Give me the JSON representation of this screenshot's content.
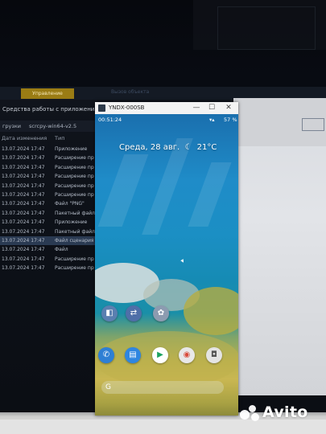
{
  "explorer": {
    "ribbon_tab": "Управление",
    "ribbon_tab2": "Вызов объекта",
    "title": "Средства работы с приложениями",
    "path_part1": "грузки",
    "path_part2": "scrcpy-win64-v2.5",
    "header_date": "Дата изменения",
    "header_type": "Тип",
    "rows": [
      {
        "date": "13.07.2024 17:47",
        "type": "Приложение"
      },
      {
        "date": "13.07.2024 17:47",
        "type": "Расширение пр"
      },
      {
        "date": "13.07.2024 17:47",
        "type": "Расширение пр"
      },
      {
        "date": "13.07.2024 17:47",
        "type": "Расширение пр"
      },
      {
        "date": "13.07.2024 17:47",
        "type": "Расширение пр"
      },
      {
        "date": "13.07.2024 17:47",
        "type": "Расширение пр"
      },
      {
        "date": "13.07.2024 17:47",
        "type": "Файл \"PNG\""
      },
      {
        "date": "13.07.2024 17:47",
        "type": "Пакетный файл"
      },
      {
        "date": "13.07.2024 17:47",
        "type": "Приложение"
      },
      {
        "date": "13.07.2024 17:47",
        "type": "Пакетный файл"
      },
      {
        "date": "13.07.2024 17:47",
        "type": "Файл сценария V"
      },
      {
        "date": "13.07.2024 17:47",
        "type": "Файл"
      },
      {
        "date": "13.07.2024 17:47",
        "type": "Расширение пр"
      },
      {
        "date": "13.07.2024 17:47",
        "type": "Расширение пр"
      }
    ],
    "selected_row": 10
  },
  "emulator": {
    "title": "YNDX-000SB",
    "min_glyph": "—",
    "max_glyph": "☐",
    "close_glyph": "✕",
    "status_time": "00:51:24",
    "battery": "57 %",
    "date": "Среда, 28 авг.",
    "temperature": "21°C"
  },
  "watermark": "Avito",
  "colors": {
    "accent": "#9a7c14",
    "selected_row": "#2a3a52"
  }
}
